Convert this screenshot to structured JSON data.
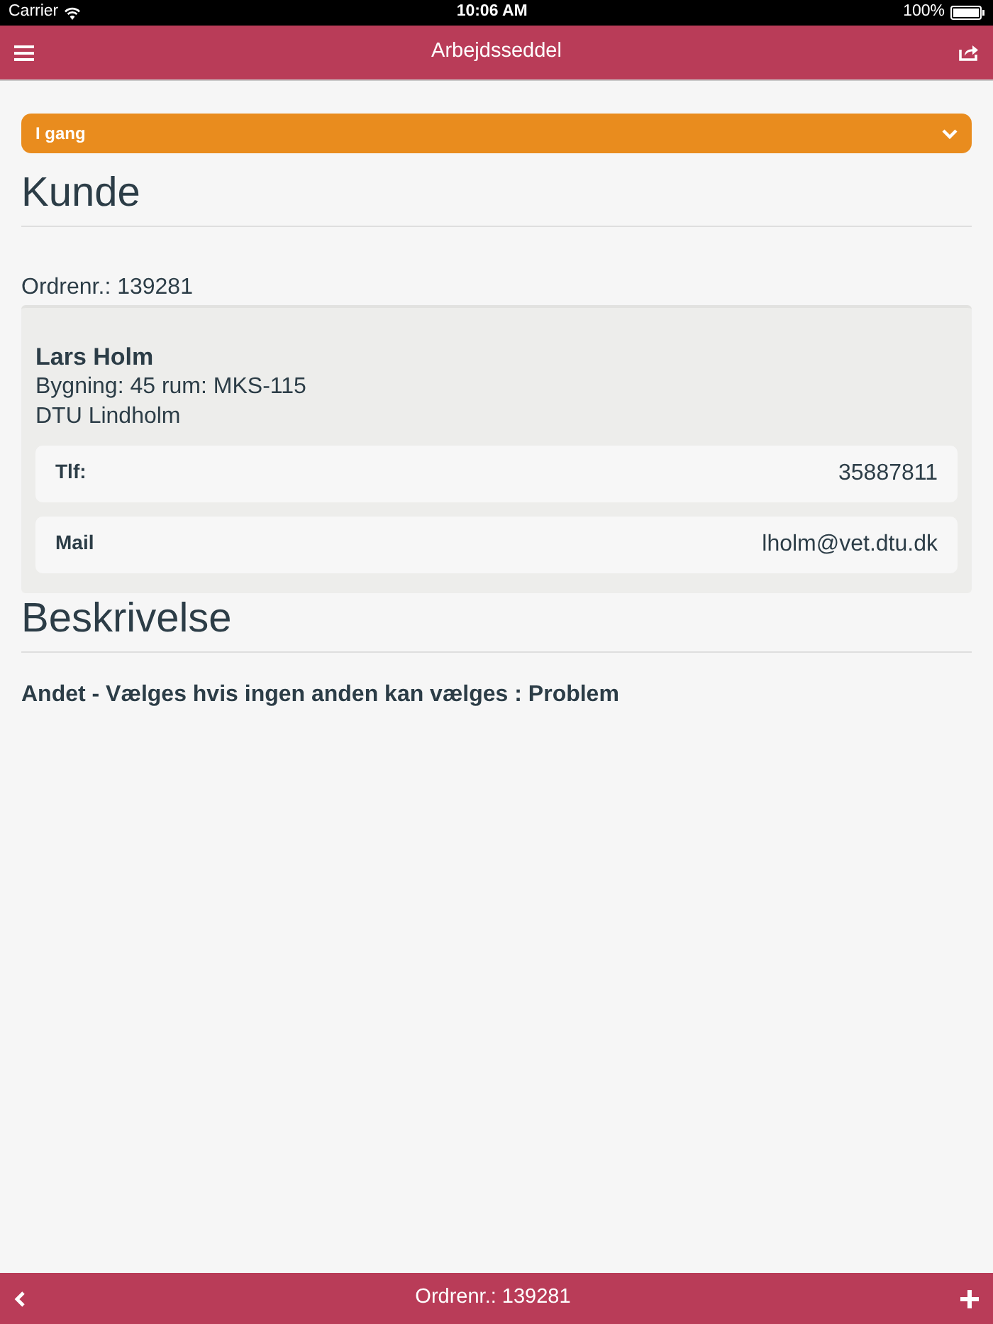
{
  "status_bar": {
    "carrier": "Carrier",
    "time": "10:06 AM",
    "battery": "100%"
  },
  "header": {
    "title": "Arbejdsseddel"
  },
  "status_select": {
    "value": "I gang"
  },
  "customer": {
    "heading": "Kunde",
    "order_number": "Ordrenr.: 139281",
    "name": "Lars Holm",
    "address_lines": [
      "Bygning: 45 rum: MKS-115",
      "DTU Lindholm"
    ],
    "contacts": [
      {
        "label": "Tlf:",
        "value": "35887811"
      },
      {
        "label": "Mail",
        "value": "lholm@vet.dtu.dk"
      }
    ]
  },
  "description": {
    "heading": "Beskrivelse",
    "text": "Andet - Vælges hvis ingen anden kan vælges : Problem"
  },
  "footer": {
    "title": "Ordrenr.: 139281"
  }
}
